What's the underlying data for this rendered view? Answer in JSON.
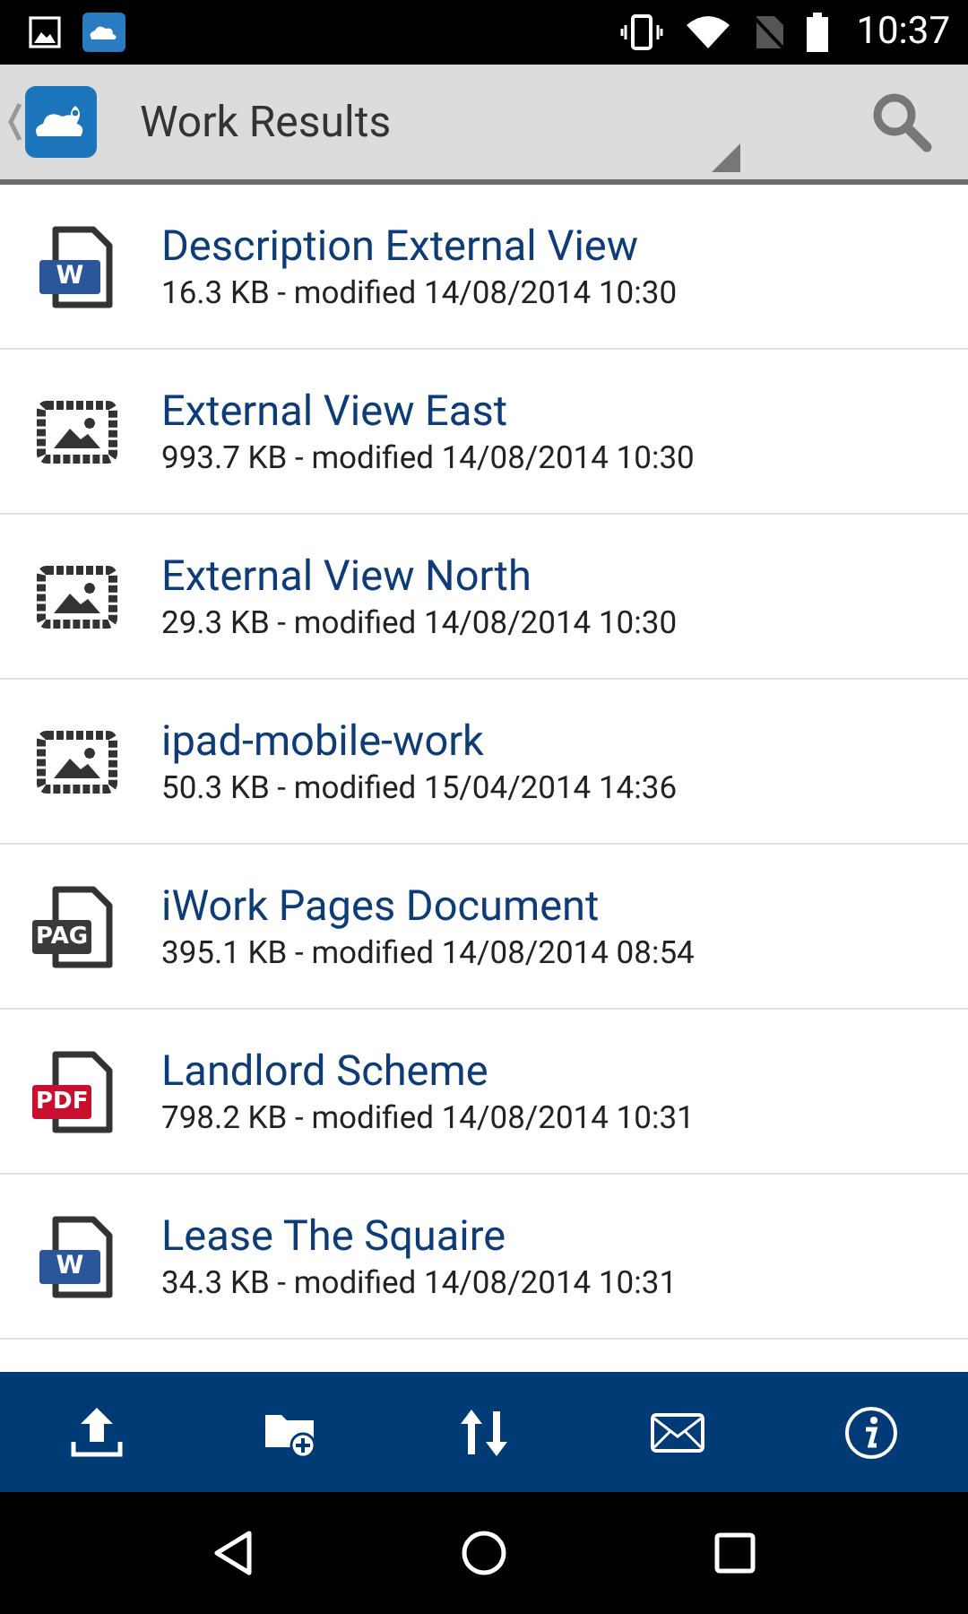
{
  "status_bar": {
    "time": "10:37"
  },
  "header": {
    "title": "Work Results"
  },
  "files": [
    {
      "kind": "word",
      "badge": "W",
      "name": "Description External View",
      "meta": "16.3 KB - modified 14/08/2014 10:30"
    },
    {
      "kind": "image",
      "name": "External View East",
      "meta": "993.7 KB - modified 14/08/2014 10:30"
    },
    {
      "kind": "image",
      "name": "External View North",
      "meta": "29.3 KB - modified 14/08/2014 10:30"
    },
    {
      "kind": "image",
      "name": "ipad-mobile-work",
      "meta": "50.3 KB - modified 15/04/2014 14:36"
    },
    {
      "kind": "pages",
      "badge": "PAG",
      "name": "iWork Pages Document",
      "meta": "395.1 KB - modified 14/08/2014 08:54"
    },
    {
      "kind": "pdf",
      "badge": "PDF",
      "name": "Landlord Scheme",
      "meta": "798.2 KB - modified 14/08/2014 10:31"
    },
    {
      "kind": "word",
      "badge": "W",
      "name": "Lease The Squaire",
      "meta": "34.3 KB - modified 14/08/2014 10:31"
    }
  ]
}
